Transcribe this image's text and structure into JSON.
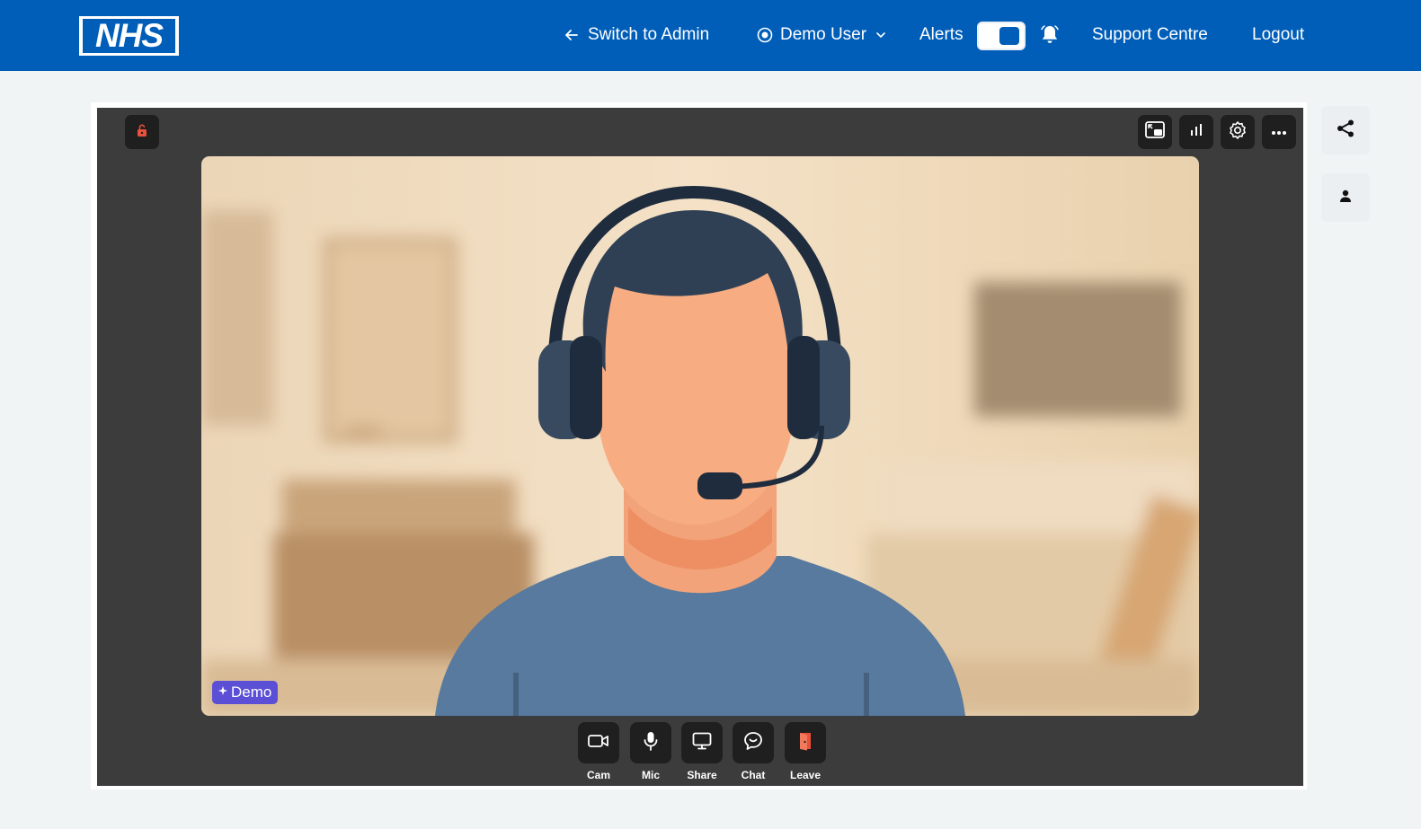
{
  "header": {
    "logo_text": "NHS",
    "switch_admin": "Switch to Admin",
    "user_name": "Demo User",
    "alerts_label": "Alerts",
    "alerts_toggle_on": true,
    "support": "Support Centre",
    "logout": "Logout"
  },
  "call": {
    "participant_badge": "Demo",
    "controls": [
      {
        "label": "Cam",
        "icon": "camera-icon"
      },
      {
        "label": "Mic",
        "icon": "microphone-icon"
      },
      {
        "label": "Share",
        "icon": "screen-share-icon"
      },
      {
        "label": "Chat",
        "icon": "chat-icon"
      },
      {
        "label": "Leave",
        "icon": "leave-door-icon"
      }
    ],
    "top_right_icons": [
      "picture-in-picture-icon",
      "stats-icon",
      "gear-icon",
      "more-icon"
    ],
    "top_left_icon": "unlock-icon"
  },
  "side_rail": {
    "icons": [
      "share-icon",
      "person-icon"
    ]
  },
  "colors": {
    "brand": "#005eb8",
    "call_bg": "#3c3c3c",
    "button_bg": "#1f1f1f",
    "leave": "#e8513a",
    "badge": "#5b4fd6"
  }
}
